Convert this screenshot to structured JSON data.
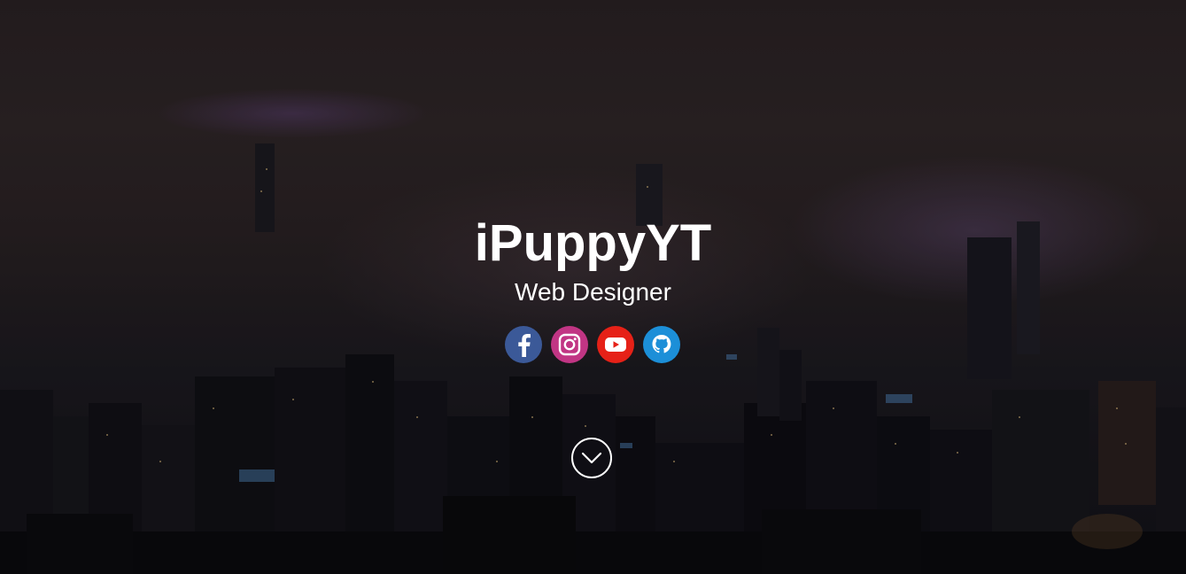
{
  "hero": {
    "title": "iPuppyYT",
    "subtitle": "Web Designer"
  },
  "social_links": [
    {
      "name": "facebook-icon",
      "color": "#3b5998"
    },
    {
      "name": "instagram-icon",
      "color": "#c13584"
    },
    {
      "name": "youtube-icon",
      "color": "#e62117"
    },
    {
      "name": "github-icon",
      "color": "#1c8fd8"
    }
  ],
  "scroll_button": {
    "icon": "chevron-down-icon"
  },
  "colors": {
    "text": "#ffffff",
    "background": "#1a1517"
  }
}
